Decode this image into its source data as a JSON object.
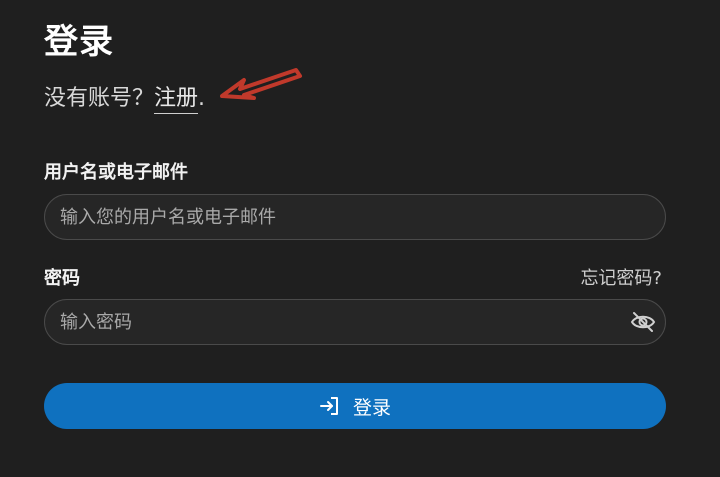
{
  "page": {
    "title": "登录",
    "signup_prompt": "没有账号？",
    "signup_link": "注册",
    "signup_suffix": "."
  },
  "form": {
    "username_label": "用户名或电子邮件",
    "username_placeholder": "输入您的用户名或电子邮件",
    "username_value": "",
    "password_label": "密码",
    "forgot_password": "忘记密码?",
    "password_placeholder": "输入密码",
    "password_value": "",
    "submit_label": "登录"
  },
  "icons": {
    "annotation": "arrow-icon",
    "password_toggle": "eye-off-icon",
    "submit": "login-icon"
  },
  "colors": {
    "background": "#1f1f1f",
    "primary_button": "#0f71bf",
    "annotation_arrow": "#c0392b"
  }
}
